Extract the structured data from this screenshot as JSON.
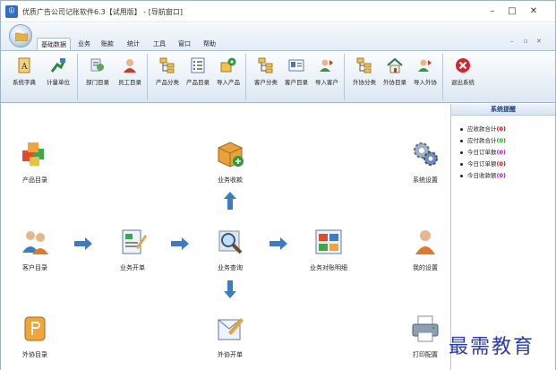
{
  "window": {
    "title": "优质广告公司记账软件6.3【试用版】 - [导航窗口]",
    "minimize": "–",
    "maximize": "□",
    "close": "✕",
    "app_icon": "Ⓛ"
  },
  "tabs": [
    "基础数据",
    "业务",
    "账款",
    "统计",
    "工具",
    "窗口",
    "帮助"
  ],
  "mdi_controls": [
    "–",
    "▫",
    "✕"
  ],
  "ribbon": {
    "buttons": [
      {
        "label": "系统字典",
        "icon": "dictionary-icon"
      },
      {
        "label": "计量单位",
        "icon": "unit-icon"
      },
      {
        "label": "部门目录",
        "icon": "department-icon"
      },
      {
        "label": "员工目录",
        "icon": "employee-icon"
      },
      {
        "label": "产品分类",
        "icon": "category-tree-icon"
      },
      {
        "label": "产品目录",
        "icon": "product-list-icon"
      },
      {
        "label": "导入产品",
        "icon": "import-icon"
      },
      {
        "label": "客户分类",
        "icon": "category-tree-icon"
      },
      {
        "label": "客户目录",
        "icon": "customer-card-icon"
      },
      {
        "label": "导入客户",
        "icon": "import-icon"
      },
      {
        "label": "外协分类",
        "icon": "category-tree-icon"
      },
      {
        "label": "外协目录",
        "icon": "house-icon"
      },
      {
        "label": "导入外协",
        "icon": "import-icon"
      },
      {
        "label": "退出系统",
        "icon": "exit-icon"
      }
    ]
  },
  "nav": {
    "product_catalog": "产品目录",
    "business_receipt": "业务收款",
    "system_settings": "系统设置",
    "customer_catalog": "客户目录",
    "business_order": "业务开单",
    "business_query": "业务查询",
    "business_reconcile": "业务对账明细",
    "my_settings": "我的设置",
    "outsource_catalog": "外协目录",
    "outsource_order": "外协开单",
    "print_settings": "打印配置"
  },
  "reminders": {
    "title": "系统提醒",
    "items": [
      {
        "label": "应收款合计",
        "count": "(0)",
        "color": "red"
      },
      {
        "label": "应付款合计",
        "count": "(0)",
        "color": "green"
      },
      {
        "label": "今日订单数",
        "count": "(0)",
        "color": "mag"
      },
      {
        "label": "今日订单额",
        "count": "(0)",
        "color": "red"
      },
      {
        "label": "今日收款额",
        "count": "(0)",
        "color": "mag"
      }
    ]
  },
  "watermark": "最需教育"
}
